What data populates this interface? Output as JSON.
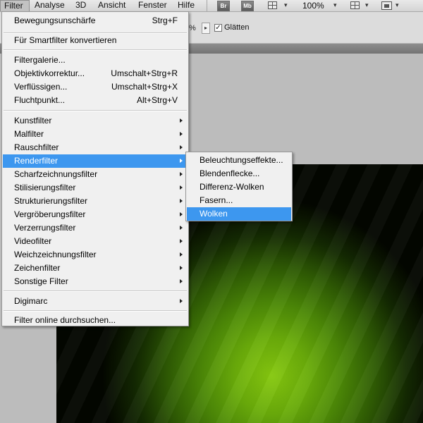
{
  "menubar": {
    "items": [
      "Filter",
      "Analyse",
      "3D",
      "Ansicht",
      "Fenster",
      "Hilfe"
    ],
    "active": "Filter",
    "icons": {
      "bridge": "Br",
      "mini_bridge": "Mb"
    },
    "zoom": "100%"
  },
  "options": {
    "percent": "%",
    "smoothing_label": "Glätten",
    "smoothing_checked": true
  },
  "filter_menu": {
    "last_filter": {
      "label": "Bewegungsunschärfe",
      "shortcut": "Strg+F"
    },
    "convert_smart": "Für Smartfilter konvertieren",
    "special": [
      {
        "label": "Filtergalerie...",
        "shortcut": ""
      },
      {
        "label": "Objektivkorrektur...",
        "shortcut": "Umschalt+Strg+R"
      },
      {
        "label": "Verflüssigen...",
        "shortcut": "Umschalt+Strg+X"
      },
      {
        "label": "Fluchtpunkt...",
        "shortcut": "Alt+Strg+V"
      }
    ],
    "groups": [
      "Kunstfilter",
      "Malfilter",
      "Rauschfilter",
      "Renderfilter",
      "Scharfzeichnungsfilter",
      "Stilisierungsfilter",
      "Strukturierungsfilter",
      "Vergröberungsfilter",
      "Verzerrungsfilter",
      "Videofilter",
      "Weichzeichnungsfilter",
      "Zeichenfilter",
      "Sonstige Filter"
    ],
    "highlighted_group": "Renderfilter",
    "digimarc": "Digimarc",
    "browse_online": "Filter online durchsuchen..."
  },
  "render_submenu": {
    "items": [
      "Beleuchtungseffekte...",
      "Blendenflecke...",
      "Differenz-Wolken",
      "Fasern...",
      "Wolken"
    ],
    "highlighted": "Wolken"
  },
  "colors": {
    "menu_highlight": "#3d97ef",
    "canvas_center": "#86c80f",
    "canvas_edge": "#030600"
  }
}
